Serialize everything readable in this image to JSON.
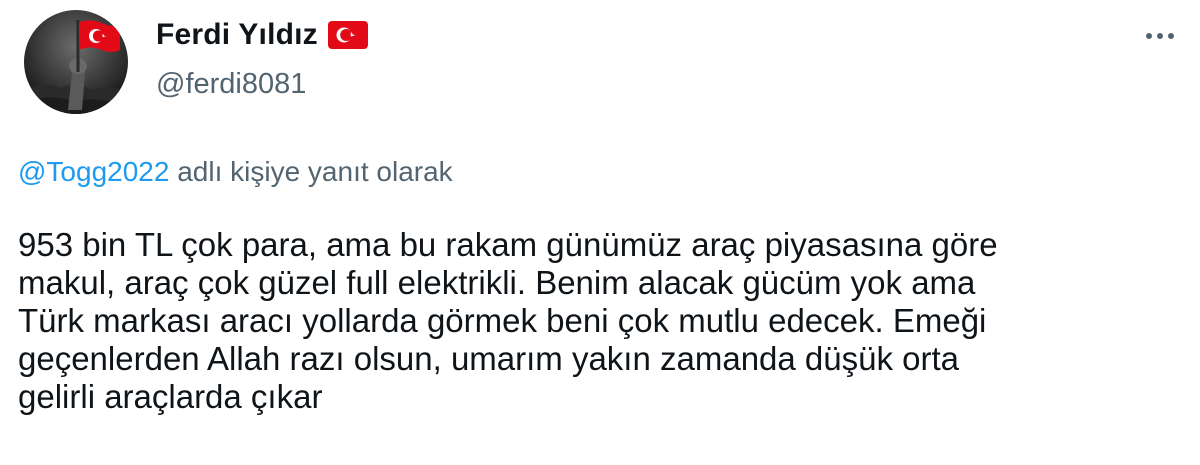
{
  "author": {
    "display_name": "Ferdi Yıldız",
    "handle": "@ferdi8081",
    "flag_icon": "turkish-flag-icon",
    "avatar_icon": "hand-holding-flag-avatar"
  },
  "menu": {
    "icon": "more-options-icon"
  },
  "reply_context": {
    "mention": "@Togg2022",
    "suffix": "adlı kişiye yanıt olarak"
  },
  "tweet": {
    "lines": [
      "953 bin TL çok para, ama bu rakam günümüz araç piyasasına göre",
      "makul, araç çok güzel full elektrikli. Benim alacak gücüm yok ama",
      "Türk markası aracı yollarda görmek beni çok mutlu edecek. Emeği",
      "geçenlerden Allah razı olsun, umarım yakın zamanda düşük orta",
      "gelirli araçlarda çıkar"
    ]
  },
  "colors": {
    "text": "#0f1419",
    "secondary": "#536471",
    "link": "#1d9bf0",
    "flag_red": "#e30a17"
  }
}
